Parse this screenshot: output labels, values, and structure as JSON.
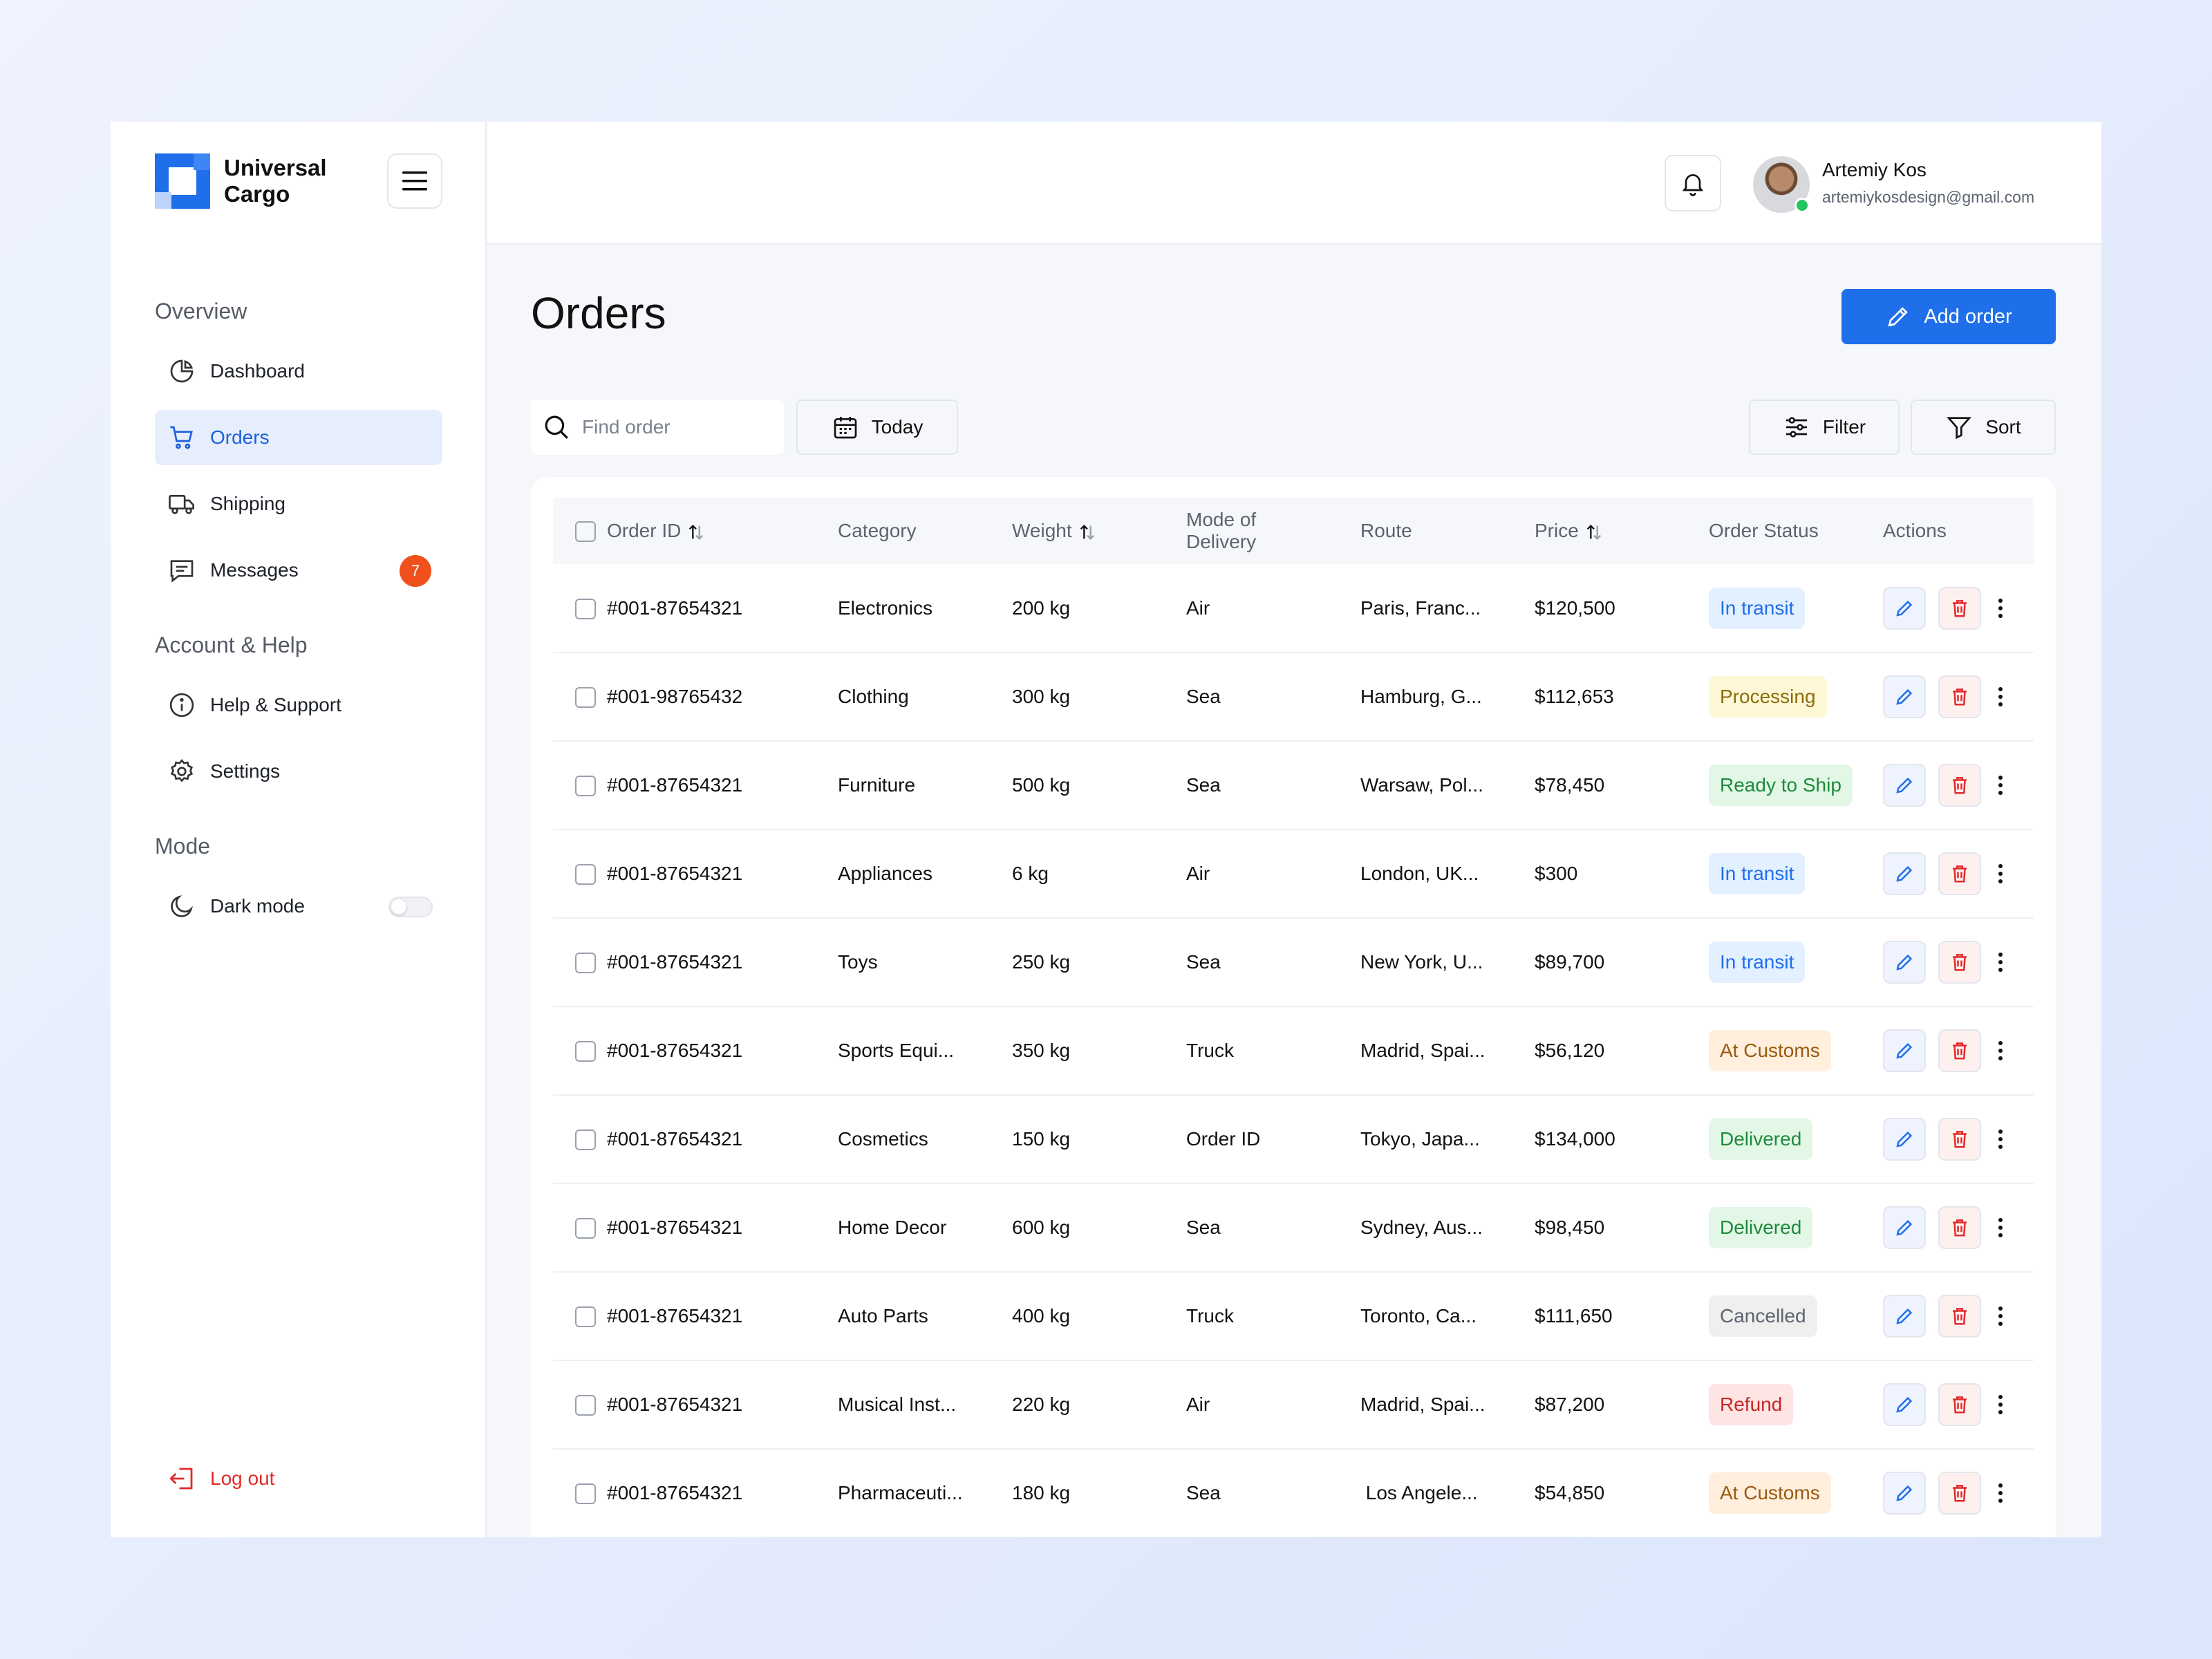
{
  "brand": {
    "name_line1": "Universal",
    "name_line2": "Cargo"
  },
  "sidebar": {
    "overview_title": "Overview",
    "items": [
      {
        "label": "Dashboard",
        "icon": "pie-chart-icon"
      },
      {
        "label": "Orders",
        "icon": "cart-icon",
        "active": true
      },
      {
        "label": "Shipping",
        "icon": "truck-icon"
      },
      {
        "label": "Messages",
        "icon": "message-icon",
        "badge": "7"
      }
    ],
    "account_title": "Account & Help",
    "account_items": [
      {
        "label": "Help & Support",
        "icon": "info-icon"
      },
      {
        "label": "Settings",
        "icon": "gear-icon"
      }
    ],
    "mode_title": "Mode",
    "dark_mode_label": "Dark mode",
    "dark_mode_on": false,
    "logout_label": "Log out"
  },
  "header": {
    "user_name": "Artemiy Kos",
    "user_email": "artemiykosdesign@gmail.com"
  },
  "page": {
    "title": "Orders",
    "add_button": "Add order",
    "search_placeholder": "Find order",
    "date_button": "Today",
    "filter_button": "Filter",
    "sort_button": "Sort"
  },
  "table": {
    "headers": {
      "order_id": "Order ID",
      "category": "Category",
      "weight": "Weight",
      "mode_line1": "Mode of",
      "mode_line2": "Delivery",
      "route": "Route",
      "price": "Price",
      "status": "Order Status",
      "actions": "Actions"
    },
    "rows": [
      {
        "id": "#001-87654321",
        "category": "Electronics",
        "weight": "200 kg",
        "mode": "Air",
        "route": "Paris, Franc...",
        "price": "$120,500",
        "status": "In transit"
      },
      {
        "id": "#001-98765432",
        "category": "Clothing",
        "weight": "300 kg",
        "mode": "Sea",
        "route": "Hamburg, G...",
        "price": "$112,653",
        "status": "Processing"
      },
      {
        "id": "#001-87654321",
        "category": "Furniture",
        "weight": "500 kg",
        "mode": "Sea",
        "route": "Warsaw, Pol...",
        "price": "$78,450",
        "status": "Ready to Ship"
      },
      {
        "id": "#001-87654321",
        "category": "Appliances",
        "weight": "6 kg",
        "mode": "Air",
        "route": "London, UK...",
        "price": "$300",
        "status": "In transit"
      },
      {
        "id": "#001-87654321",
        "category": "Toys",
        "weight": "250 kg",
        "mode": "Sea",
        "route": "New York, U...",
        "price": "$89,700",
        "status": "In transit"
      },
      {
        "id": "#001-87654321",
        "category": "Sports Equi...",
        "weight": "350 kg",
        "mode": "Truck",
        "route": "Madrid, Spai...",
        "price": "$56,120",
        "status": "At Customs"
      },
      {
        "id": "#001-87654321",
        "category": "Cosmetics",
        "weight": "150 kg",
        "mode": "Order ID",
        "route": "Tokyo, Japa...",
        "price": "$134,000",
        "status": "Delivered"
      },
      {
        "id": "#001-87654321",
        "category": "Home Decor",
        "weight": "600 kg",
        "mode": "Sea",
        "route": "Sydney, Aus...",
        "price": "$98,450",
        "status": "Delivered"
      },
      {
        "id": "#001-87654321",
        "category": "Auto Parts",
        "weight": "400 kg",
        "mode": "Truck",
        "route": "Toronto, Ca...",
        "price": "$111,650",
        "status": "Cancelled"
      },
      {
        "id": "#001-87654321",
        "category": "Musical Inst...",
        "weight": "220 kg",
        "mode": "Air",
        "route": "Madrid, Spai...",
        "price": "$87,200",
        "status": "Refund"
      },
      {
        "id": "#001-87654321",
        "category": "Pharmaceuti...",
        "weight": "180 kg",
        "mode": "Sea",
        "route": " Los Angele...",
        "price": "$54,850",
        "status": "At Customs"
      }
    ]
  },
  "status_colors": {
    "In transit": {
      "bg": "#e3f0ff",
      "fg": "#1f6feb"
    },
    "Processing": {
      "bg": "#fff8d6",
      "fg": "#8a6d0b"
    },
    "Ready to Ship": {
      "bg": "#e3f7e6",
      "fg": "#1e8a3c"
    },
    "At Customs": {
      "bg": "#ffefdc",
      "fg": "#9a5a12"
    },
    "Delivered": {
      "bg": "#e3f7e6",
      "fg": "#1e8a3c"
    },
    "Cancelled": {
      "bg": "#efefef",
      "fg": "#5c6370"
    },
    "Refund": {
      "bg": "#ffe4e4",
      "fg": "#c62828"
    }
  },
  "colors": {
    "accent": "#1f6feb",
    "badge": "#f0511c",
    "danger": "#e12b2b"
  }
}
